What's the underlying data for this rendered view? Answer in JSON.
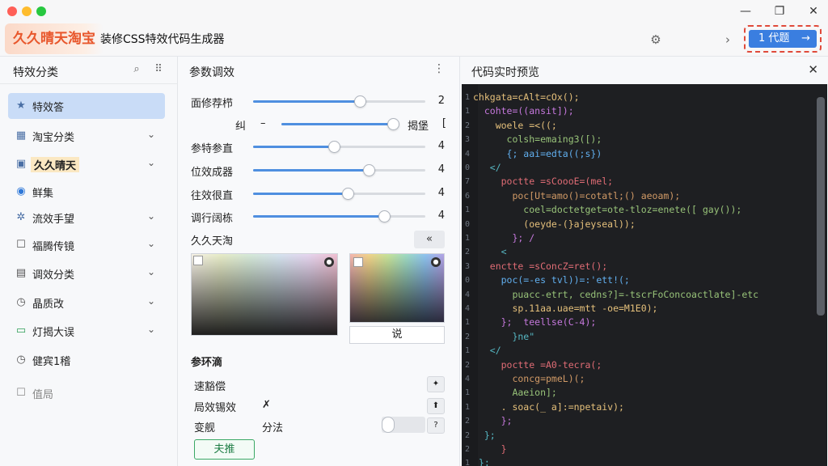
{
  "brand": "久久晴天淘宝",
  "app_title": "装修CSS特效代码生成器",
  "header": {
    "code_button": "1 代题",
    "code_arrow": "→"
  },
  "sidebar": {
    "title": "特效分类",
    "items": [
      {
        "label": "特效答",
        "icon": "star-icon"
      },
      {
        "label": "淘宝分类",
        "icon": "grid-icon"
      },
      {
        "label": "久久晴天",
        "icon": "tag-icon"
      },
      {
        "label": "鲜集",
        "icon": "location-icon"
      },
      {
        "label": "流效手望",
        "icon": "gear-icon"
      },
      {
        "label": "福腾传镜",
        "icon": "square-icon"
      },
      {
        "label": "调效分类",
        "icon": "doc-icon"
      },
      {
        "label": "晶质改",
        "icon": "clock-icon"
      },
      {
        "label": "灯揭大误",
        "icon": "folder-icon"
      },
      {
        "label": "健宾1稽",
        "icon": "clock-icon"
      },
      {
        "label": "值局",
        "icon": "checkbox-icon"
      }
    ]
  },
  "params": {
    "title": "参数调效",
    "sliders": [
      {
        "label": "面修荐栉",
        "value": "2",
        "fraction": 0.62
      },
      {
        "label": "纠",
        "mid_label": "–",
        "end_label": "揭堡",
        "value": "[",
        "fraction": 0.95
      },
      {
        "label": "参特参直",
        "value": "4",
        "fraction": 0.47
      },
      {
        "label": "位效成器",
        "value": "4",
        "fraction": 0.67
      },
      {
        "label": "往效很直",
        "value": "4",
        "fraction": 0.55
      },
      {
        "label": "调行阔栋",
        "value": "4",
        "fraction": 0.76
      }
    ],
    "palette_label": "久久天淘",
    "collapse": "«",
    "apply": "说",
    "section_title": "参环滴",
    "options": [
      {
        "label": "速豁偿",
        "value": ""
      },
      {
        "label": "局效锡效",
        "value": "✗"
      },
      {
        "label": "变舰",
        "value": "分法"
      }
    ],
    "confirm": "夫推"
  },
  "code_preview": {
    "title": "代码实时预览",
    "lines": [
      {
        "t": "chkgata=cAlt=cOx();",
        "c": "#e6c07b"
      },
      {
        "t": "  cohte=((ansit]);",
        "c": "#c678dd"
      },
      {
        "t": "    woele =<((;",
        "c": "#e5c07b"
      },
      {
        "t": "      colsh=emaing3([);",
        "c": "#98c379"
      },
      {
        "t": "      {; aai=edta((;s})",
        "c": "#61afef"
      },
      {
        "t": "   </",
        "c": "#56b6c2"
      },
      {
        "t": "     poctte =sCoooE=(mel;",
        "c": "#e06c75"
      },
      {
        "t": "       poc[Ut=amo()=cotatl;() aeoam);",
        "c": "#d19a66"
      },
      {
        "t": "         coel=doctetget=ote-tloz=enete([ gay());",
        "c": "#98c379"
      },
      {
        "t": "         (oeyde-(}ajeyseal));",
        "c": "#e5c07b"
      },
      {
        "t": "       }; /",
        "c": "#c678dd"
      },
      {
        "t": "     <",
        "c": "#56b6c2"
      },
      {
        "t": "   enctte =sConcZ=ret();",
        "c": "#e06c75"
      },
      {
        "t": "     poc(=-es tvl))=:'ett!(;",
        "c": "#61afef"
      },
      {
        "t": "       puacc-etrt, cedns?]=-tscrFoConcoactlate]-etc",
        "c": "#98c379"
      },
      {
        "t": "       sp.11aa.uae=mtt -oe=M1E0);",
        "c": "#e5c07b"
      },
      {
        "t": "     };  teellse(C-4);",
        "c": "#c678dd"
      },
      {
        "t": "       }ne\"",
        "c": "#56b6c2"
      },
      {
        "t": "   </",
        "c": "#56b6c2"
      },
      {
        "t": "     poctte =A0-tecra(;",
        "c": "#e06c75"
      },
      {
        "t": "       concg=pmeL)(;",
        "c": "#d19a66"
      },
      {
        "t": "       Aaeion];",
        "c": "#98c379"
      },
      {
        "t": "     . soac(_ a]:=npetaiv);",
        "c": "#e5c07b"
      },
      {
        "t": "     };",
        "c": "#c678dd"
      },
      {
        "t": "  };",
        "c": "#56b6c2"
      },
      {
        "t": "     }",
        "c": "#e06c75"
      },
      {
        "t": " };",
        "c": "#56b6c2"
      }
    ],
    "line_numbers": [
      "1",
      "1",
      "2",
      "3",
      "4",
      "0",
      "7",
      "6",
      "1",
      "0",
      "1",
      "2",
      "3",
      "0",
      "4",
      "4",
      "1",
      "2",
      "1",
      "2",
      "4",
      "1",
      "1",
      "2",
      "2",
      "2",
      "1"
    ]
  }
}
